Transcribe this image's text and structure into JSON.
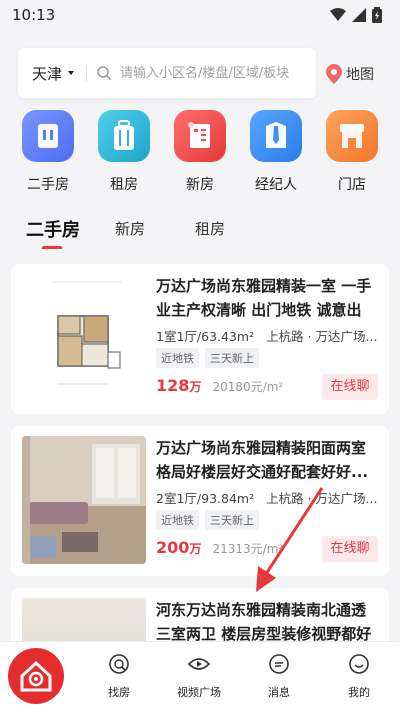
{
  "status": {
    "time": "10:13"
  },
  "search": {
    "city": "天津",
    "placeholder": "请输入小区名/楼盘/区域/板块",
    "map_label": "地图"
  },
  "categories": [
    {
      "label": "二手房",
      "icon": "second-hand-house-icon",
      "color": "#5b7cf5"
    },
    {
      "label": "租房",
      "icon": "luggage-icon",
      "color": "#2fb4d6"
    },
    {
      "label": "新房",
      "icon": "new-house-icon",
      "color": "#f0504f"
    },
    {
      "label": "经纪人",
      "icon": "agent-tie-icon",
      "color": "#3b8ef3"
    },
    {
      "label": "门店",
      "icon": "store-icon",
      "color": "#f7883a"
    }
  ],
  "tabs": [
    {
      "label": "二手房",
      "active": true
    },
    {
      "label": "新房",
      "active": false
    },
    {
      "label": "租房",
      "active": false
    }
  ],
  "listings": [
    {
      "title": "万达广场尚东雅园精装一室 一手业主产权清晰 出门地铁 诚意出",
      "spec": "1室1厅/63.43m²",
      "location": "上杭路 · 万达广场...",
      "tags": [
        "近地铁",
        "三天新上"
      ],
      "price": "128",
      "price_unit": "万",
      "unit_price": "20180元/m²",
      "chat_label": "在线聊"
    },
    {
      "title": "万达广场尚东雅园精装阳面两室 格局好楼层好交通好配套好好...",
      "spec": "2室1厅/93.84m²",
      "location": "上杭路 · 万达广场...",
      "tags": [
        "近地铁",
        "三天新上"
      ],
      "price": "200",
      "price_unit": "万",
      "unit_price": "21313元/m²",
      "chat_label": "在线聊"
    },
    {
      "title": "河东万达尚东雅园精装南北通透 三室两卫 楼层房型装修视野都好"
    }
  ],
  "bottom_nav": [
    {
      "label": "",
      "icon": "home-logo-icon"
    },
    {
      "label": "找房",
      "icon": "find-house-icon"
    },
    {
      "label": "视频广场",
      "icon": "video-icon"
    },
    {
      "label": "消息",
      "icon": "message-icon"
    },
    {
      "label": "我的",
      "icon": "profile-icon"
    }
  ],
  "colors": {
    "accent": "#e8383d",
    "background": "#f4f4f6"
  }
}
